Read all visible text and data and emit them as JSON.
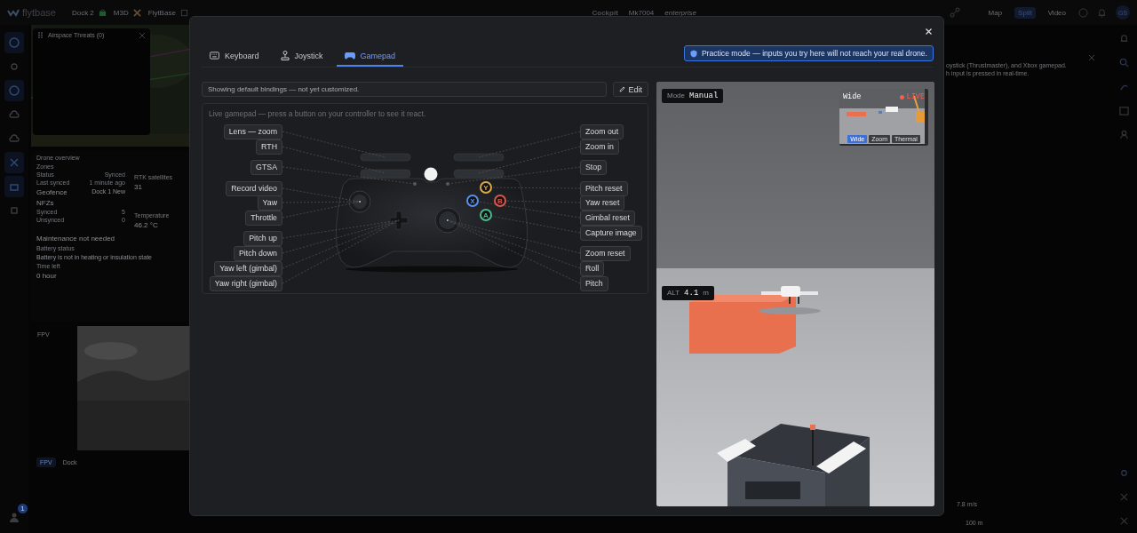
{
  "app_bar": {
    "logo": "flytbase",
    "context": [
      {
        "label": "Dock 2"
      },
      {
        "label": "M3D"
      },
      {
        "label": "FlytBase"
      }
    ],
    "title": "Cockpit",
    "device": "Mk7004",
    "plan": "enterprise",
    "views": [
      {
        "label": "Map",
        "selected": false
      },
      {
        "label": "Split",
        "selected": true
      },
      {
        "label": "Video",
        "selected": false
      }
    ],
    "avatar": "GS"
  },
  "left_rail": {
    "badge": "1"
  },
  "airspace_panel": {
    "title": "Airspace Threats (0)"
  },
  "drone_overview": {
    "title": "Drone overview",
    "zones_title": "Zones",
    "zone_rows": [
      {
        "label": "Status",
        "value": "Synced"
      },
      {
        "label": "Last synced",
        "value": "1 minute ago"
      }
    ],
    "geofence": {
      "label": "Geofence",
      "value": "Dock 1 New"
    },
    "nfz_title": "NFZs",
    "nfz_rows": [
      {
        "label": "Synced",
        "value": "5"
      },
      {
        "label": "Unsynced",
        "value": "0"
      }
    ],
    "rtk": {
      "label": "RTK satellites",
      "value": "31"
    },
    "temperature": {
      "label": "Temperature",
      "value": "46.2 °C"
    },
    "maintenance": "Maintenance not needed",
    "battery": {
      "label": "Battery status",
      "value": "Battery is not in heating or insulation state"
    },
    "time_left": {
      "label": "Time left",
      "value": "0 hour"
    }
  },
  "fpv": {
    "title": "FPV",
    "tabs": [
      {
        "label": "FPV",
        "selected": true
      },
      {
        "label": "Dock",
        "selected": false
      }
    ]
  },
  "help_text": [
    "oystick (Thrustmaster), and Xbox gamepad.",
    "h input is pressed in real-time."
  ],
  "telemetry": [
    "7.8 m/s",
    "100 m"
  ],
  "dialog": {
    "tabs": [
      {
        "label": "Keyboard",
        "selected": false
      },
      {
        "label": "Joystick",
        "selected": false
      },
      {
        "label": "Gamepad",
        "selected": true
      }
    ],
    "notice": "Practice mode — inputs you try here will not reach your real drone.",
    "bindings_status": "Showing default bindings — not yet customized.",
    "edit_button": "Edit",
    "gamepad": {
      "caption": "Live gamepad — press a button on your controller to see it react.",
      "left_labels": [
        {
          "label": "Lens — zoom",
          "kind": "lb"
        },
        {
          "label": "RTH",
          "kind": "lt"
        },
        {
          "label": "GTSA",
          "kind": "select"
        },
        {
          "label": "Record video",
          "kind": "lstick"
        },
        {
          "label": "Yaw",
          "kind": "lstick"
        },
        {
          "label": "Throttle",
          "kind": "lstick"
        },
        {
          "label": "Pitch up",
          "kind": "dpad"
        },
        {
          "label": "Pitch down",
          "kind": "dpad"
        },
        {
          "label": "Yaw left (gimbal)",
          "kind": "dpad"
        },
        {
          "label": "Yaw right (gimbal)",
          "kind": "dpad"
        }
      ],
      "right_labels": [
        {
          "label": "Zoom out",
          "kind": "rb"
        },
        {
          "label": "Zoom in",
          "kind": "rt"
        },
        {
          "label": "Stop",
          "kind": "start"
        },
        {
          "label": "Pitch reset",
          "kind": "y"
        },
        {
          "label": "Yaw reset",
          "kind": "b"
        },
        {
          "label": "Gimbal reset",
          "kind": "x"
        },
        {
          "label": "Capture image",
          "kind": "a"
        },
        {
          "label": "Zoom reset",
          "kind": "rstick"
        },
        {
          "label": "Roll",
          "kind": "rstick"
        },
        {
          "label": "Pitch",
          "kind": "rstick"
        }
      ],
      "face_buttons": [
        {
          "label": "Y",
          "color": "#d9a94a"
        },
        {
          "label": "X",
          "color": "#5b8fe8"
        },
        {
          "label": "B",
          "color": "#d9574e"
        },
        {
          "label": "A",
          "color": "#4fb88a"
        }
      ]
    },
    "simulator": {
      "mode_label": "Mode",
      "mode": "Manual",
      "camera": {
        "lens": "Wide",
        "live": "LIVE",
        "lenses": [
          {
            "label": "Wide",
            "selected": true
          },
          {
            "label": "Zoom",
            "selected": false
          },
          {
            "label": "Thermal",
            "selected": false
          }
        ]
      },
      "altitude": {
        "label": "ALT",
        "value": "4.1",
        "unit": "m"
      }
    }
  }
}
